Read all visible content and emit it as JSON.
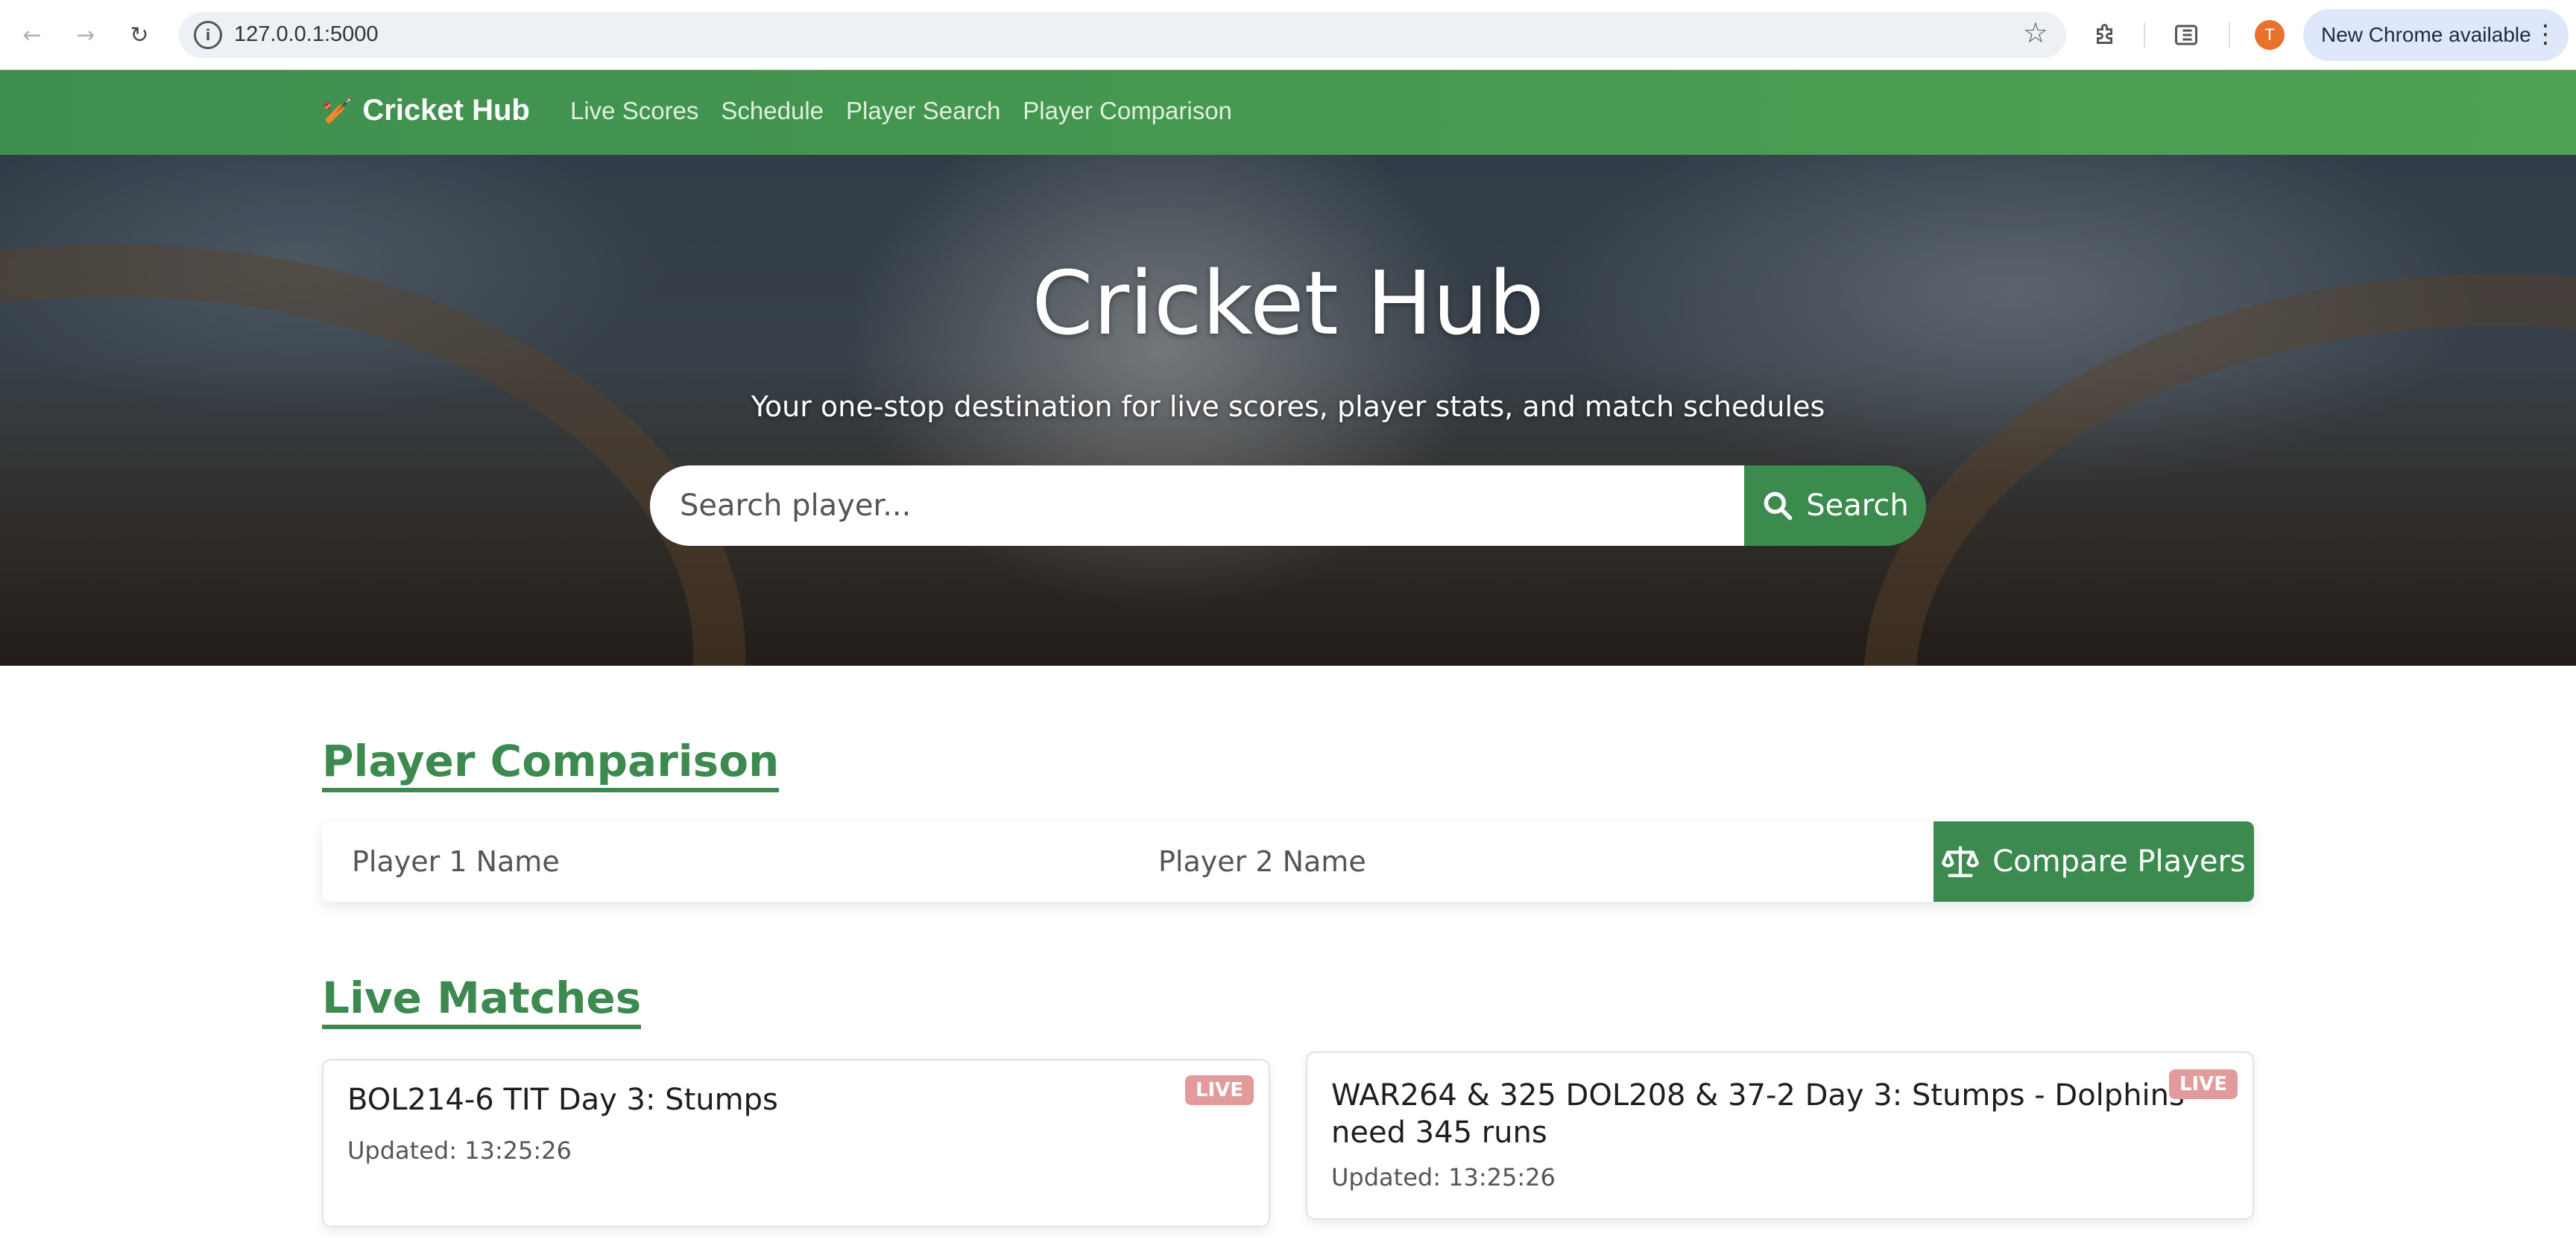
{
  "browser": {
    "url": "127.0.0.1:5000",
    "profile_initial": "T",
    "update_label": "New Chrome available",
    "icons": {
      "back": "arrow-left-icon",
      "forward": "arrow-right-icon",
      "reload": "reload-icon",
      "site_info": "info-icon",
      "bookmark": "star-icon",
      "extensions": "puzzle-icon",
      "reader": "reading-list-icon",
      "menu": "kebab-icon"
    },
    "colors": {
      "avatar": "#e8712c",
      "update_pill": "#dfe8fb"
    }
  },
  "navbar": {
    "brand": "Cricket Hub",
    "brand_icon": "cricket-bat-icon",
    "links": [
      "Live Scores",
      "Schedule",
      "Player Search",
      "Player Comparison"
    ],
    "color": "#4a9a50"
  },
  "hero": {
    "title": "Cricket Hub",
    "subtitle": "Your one-stop destination for live scores, player stats, and match schedules",
    "search_placeholder": "Search player...",
    "search_button": "Search"
  },
  "comparison": {
    "heading": "Player Comparison",
    "player1_placeholder": "Player 1 Name",
    "player2_placeholder": "Player 2 Name",
    "button": "Compare Players",
    "button_icon": "balance-scale-icon"
  },
  "live": {
    "heading": "Live Matches",
    "matches": [
      {
        "title": "BOL214-6 TIT Day 3: Stumps",
        "updated": "Updated: 13:25:26",
        "badge": "LIVE"
      },
      {
        "title": "WAR264 & 325 DOL208 & 37-2 Day 3: Stumps - Dolphins need 345 runs",
        "updated": "Updated: 13:25:26",
        "badge": "LIVE"
      }
    ]
  },
  "theme": {
    "accent": "#3c8a4f",
    "badge": "#e39a9a"
  }
}
